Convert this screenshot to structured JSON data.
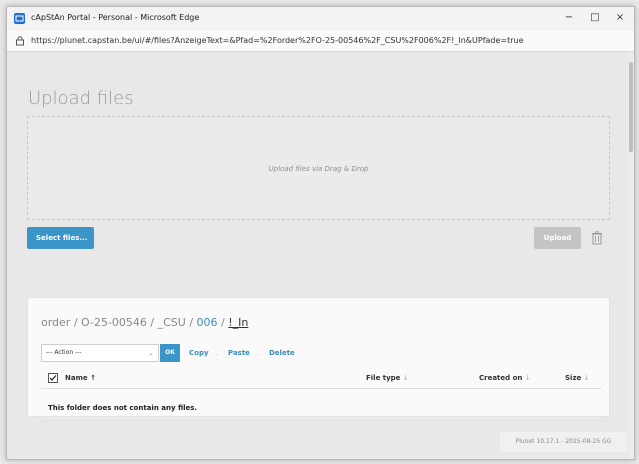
{
  "window": {
    "title": "cApStAn Portal - Personal - Microsoft Edge",
    "minimize": "−",
    "maximize": "□",
    "close": "×"
  },
  "address": {
    "url": "https://plunet.capstan.be/ui/#/files?AnzeigeText=&Pfad=%2Forder%2FO-25-00546%2F_CSU%2F006%2F!_In&UPfade=true"
  },
  "upload": {
    "title": "Upload files",
    "dropzone_text": "Upload files via Drag & Drop",
    "select_button": "Select files...",
    "upload_button": "Upload"
  },
  "folder": {
    "breadcrumb": {
      "prefix": "order / O-25-00546 / _CSU / ",
      "link": "006",
      "sep": " / ",
      "current": "!_In"
    },
    "action_select": "--- Action ---",
    "ok_button": "OK",
    "actions": [
      "Copy",
      "Paste",
      "Delete"
    ],
    "columns": {
      "name": "Name",
      "file_type": "File type",
      "created_on": "Created on",
      "size": "Size"
    },
    "sort_up": "↑",
    "sort_down": "↓",
    "empty_message": "This folder does not contain any files."
  },
  "footer": {
    "version": "Plunet 10.17.1 - 2025-08-25 GG"
  }
}
